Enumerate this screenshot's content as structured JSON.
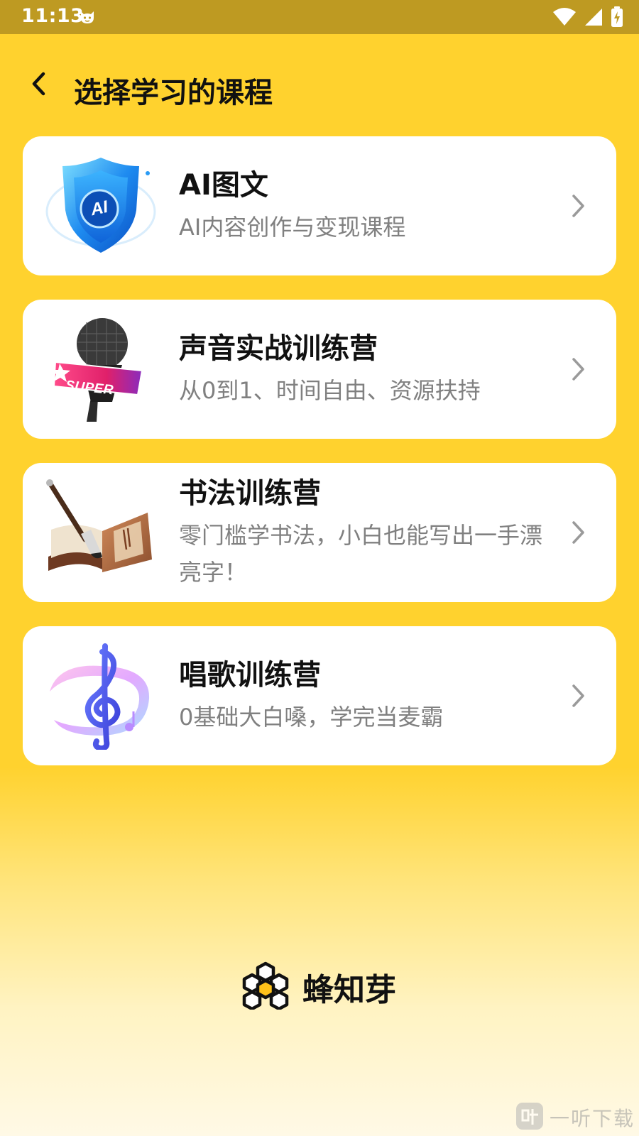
{
  "status_bar": {
    "time": "11:13",
    "icons": [
      "cat-notification-icon",
      "wifi-icon",
      "cellular-signal-icon",
      "battery-charging-icon"
    ]
  },
  "header": {
    "back_icon": "chevron-left-icon",
    "title": "选择学习的课程"
  },
  "courses": [
    {
      "title": "AI图文",
      "subtitle": "AI内容创作与变现课程",
      "icon": "ai-shield-icon",
      "thumb_label": "AI"
    },
    {
      "title": "声音实战训练营",
      "subtitle": "从0到1、时间自由、资源扶持",
      "icon": "microphone-icon",
      "thumb_label": "SUPER"
    },
    {
      "title": "书法训练营",
      "subtitle": "零门槛学书法，小白也能写出一手漂亮字！",
      "icon": "calligraphy-brush-book-icon"
    },
    {
      "title": "唱歌训练营",
      "subtitle": "0基础大白嗓，学完当麦霸",
      "icon": "treble-clef-icon"
    }
  ],
  "brand": {
    "name": "蜂知芽",
    "logo_icon": "honeycomb-logo-icon"
  },
  "watermark": {
    "text": "一听下载",
    "icon": "ting-logo-icon"
  },
  "colors": {
    "background": "#FFD22E",
    "status_bar": "#BE9A22",
    "card": "#FFFFFF",
    "title_text": "#111111",
    "subtitle_text": "#808080"
  }
}
